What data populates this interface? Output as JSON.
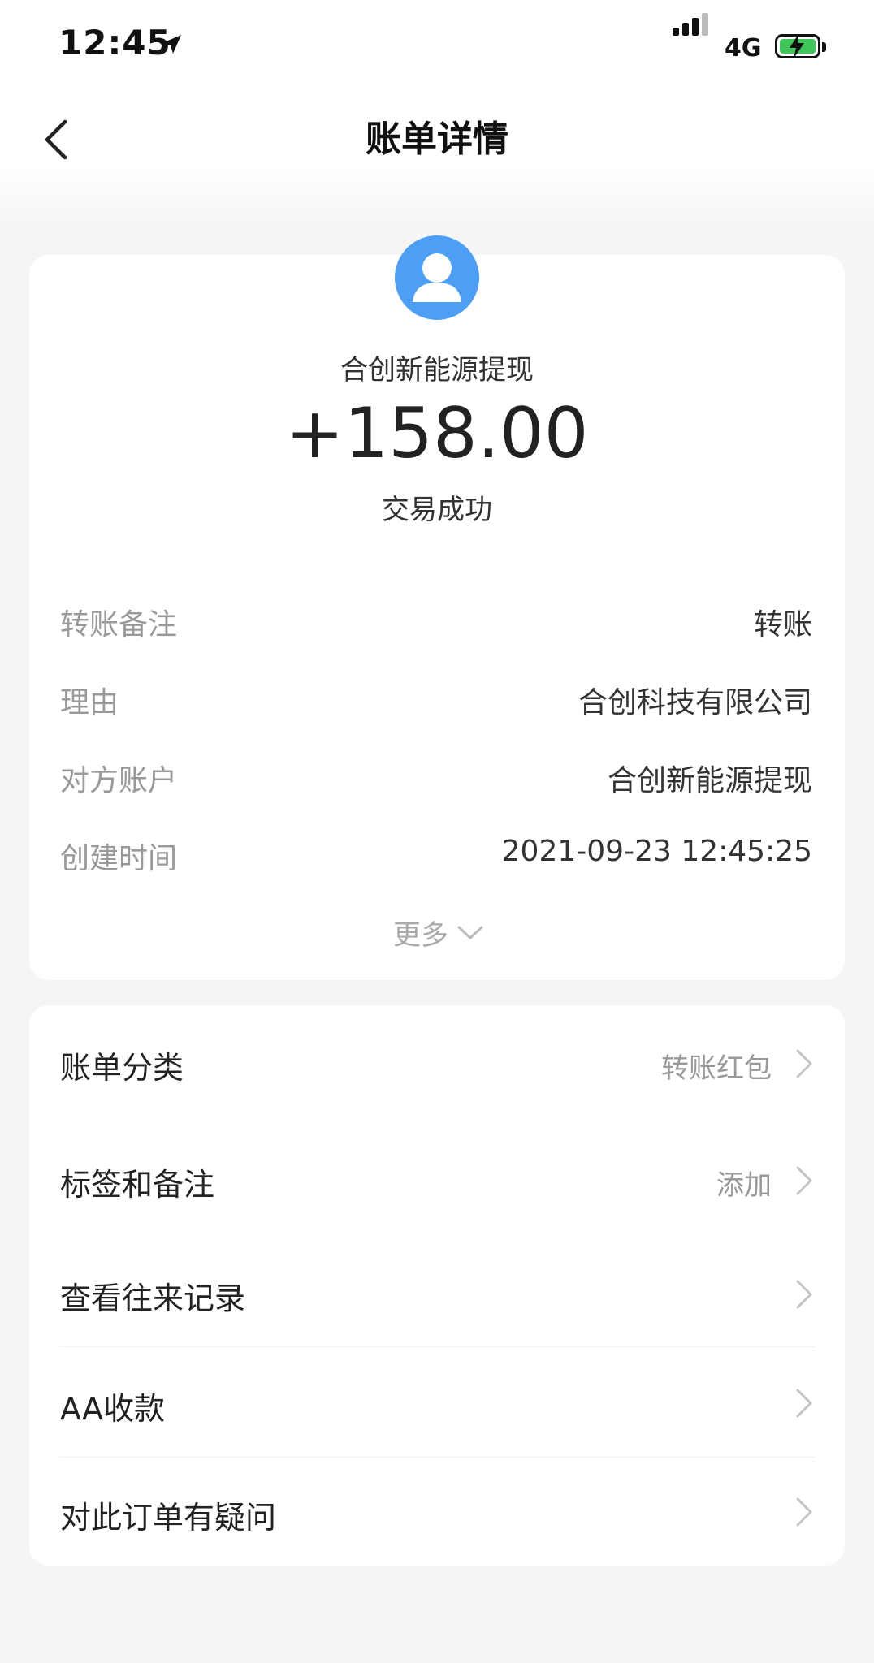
{
  "status_bar": {
    "time": "12:45",
    "network": "4G",
    "icons": [
      "location-arrow-icon",
      "signal-icon",
      "battery-charging-icon"
    ]
  },
  "nav": {
    "title": "账单详情",
    "back_icon": "chevron-left-icon"
  },
  "summary": {
    "avatar_icon": "user-avatar-icon",
    "payee": "合创新能源提现",
    "amount": "+158.00",
    "status": "交易成功"
  },
  "details": [
    {
      "label": "转账备注",
      "value": "转账"
    },
    {
      "label": "理由",
      "value": "合创科技有限公司"
    },
    {
      "label": "对方账户",
      "value": "合创新能源提现"
    },
    {
      "label": "创建时间",
      "value": "2021-09-23 12:45:25"
    }
  ],
  "more": {
    "label": "更多",
    "icon": "chevron-down-icon"
  },
  "menu": [
    {
      "label": "账单分类",
      "value": "转账红包"
    },
    {
      "label": "标签和备注",
      "value": "添加"
    },
    {
      "label": "查看往来记录",
      "value": ""
    },
    {
      "label": "AA收款",
      "value": ""
    },
    {
      "label": "对此订单有疑问",
      "value": ""
    }
  ],
  "colors": {
    "background": "#f5f5f5",
    "card": "#ffffff",
    "avatar": "#4d9ff5",
    "label_gray": "#999999",
    "battery_green": "#3fc55a"
  }
}
